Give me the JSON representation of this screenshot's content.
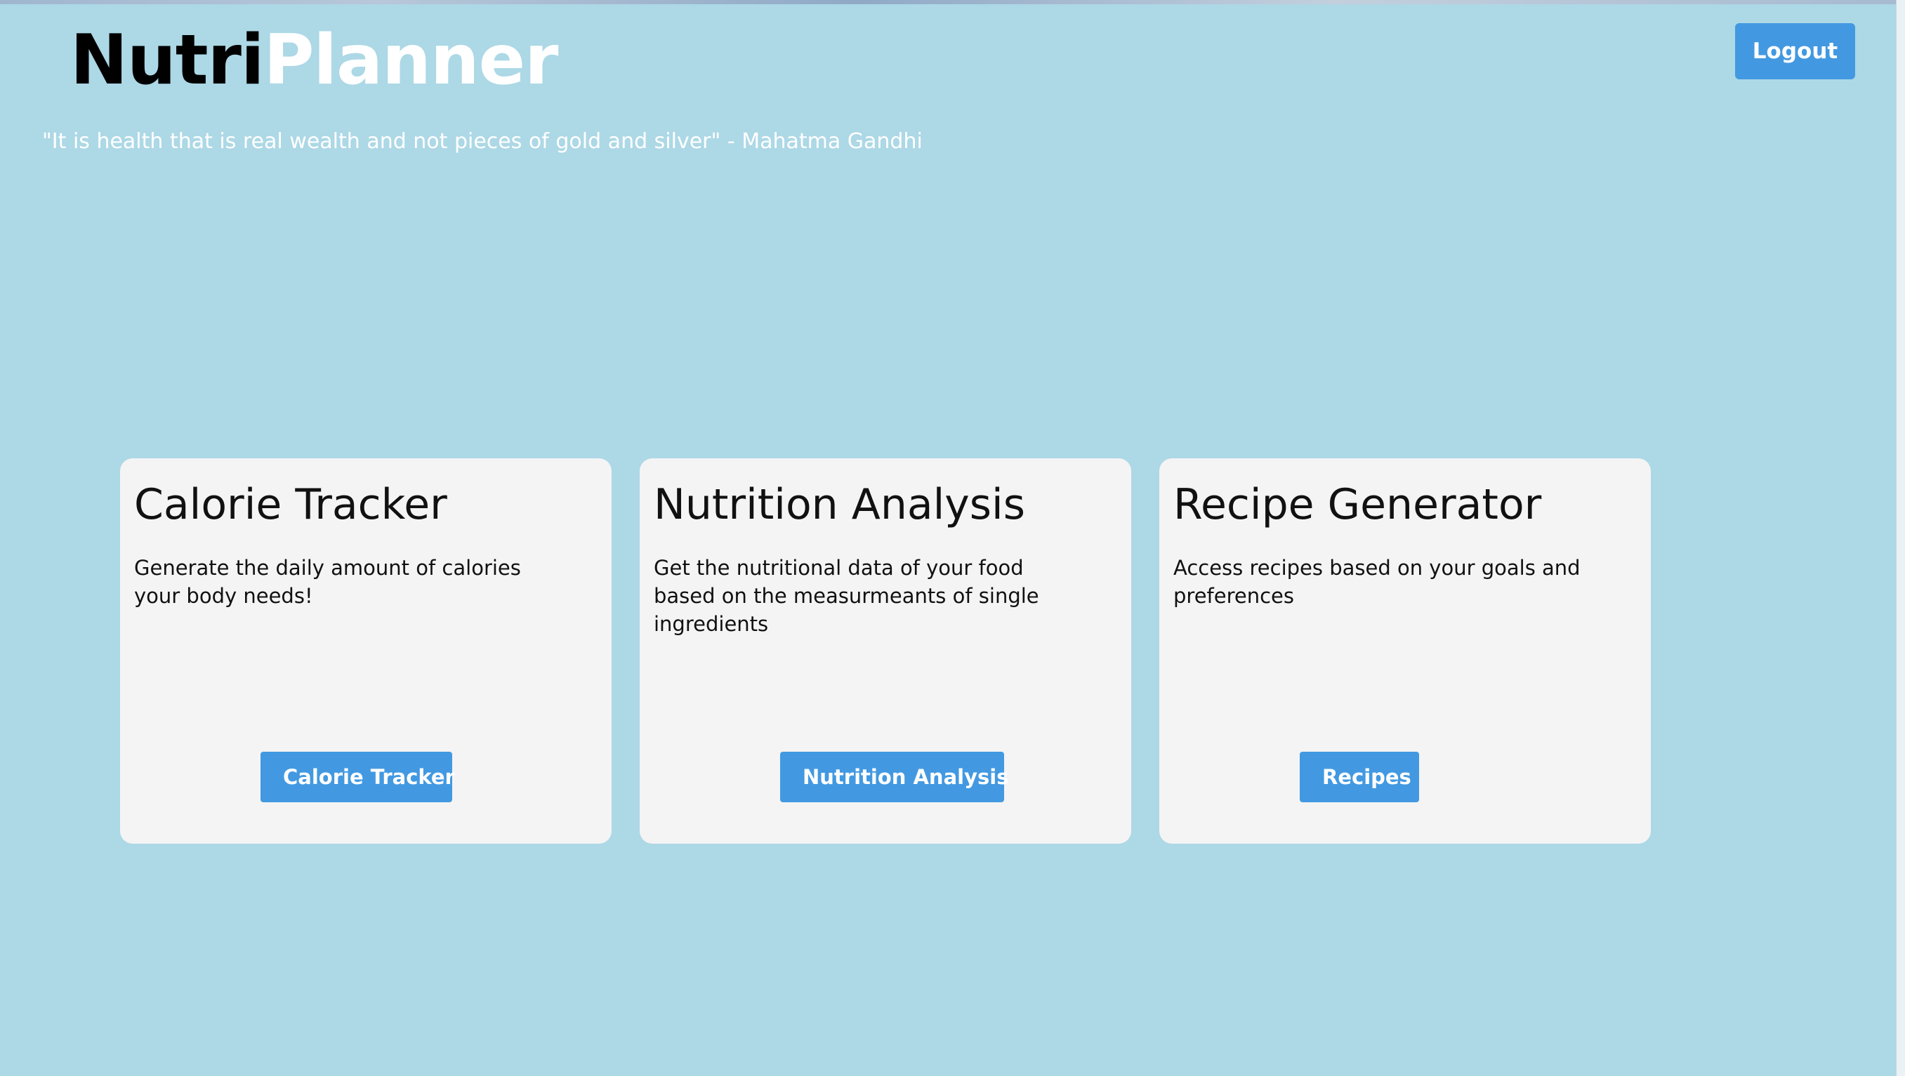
{
  "header": {
    "logo_part1": "Nutri",
    "logo_part2": "Planner",
    "quote": "\"It is health that is real wealth and not pieces of gold and silver\" - Mahatma Gandhi",
    "logout_label": "Logout"
  },
  "cards": [
    {
      "title": "Calorie Tracker",
      "description": "Generate the daily amount of calories your body needs!",
      "button_label": "Calorie Tracker"
    },
    {
      "title": "Nutrition Analysis",
      "description": "Get the nutritional data of your food based on the measurmeants of single ingredients",
      "button_label": "Nutrition Analysis"
    },
    {
      "title": "Recipe Generator",
      "description": "Access recipes based on your goals and preferences",
      "button_label": "Recipes"
    }
  ],
  "colors": {
    "background": "#add8e6",
    "card_background": "#f4f4f4",
    "accent_button": "#4299e1",
    "logo_dark": "#000000",
    "logo_light": "#ffffff"
  }
}
